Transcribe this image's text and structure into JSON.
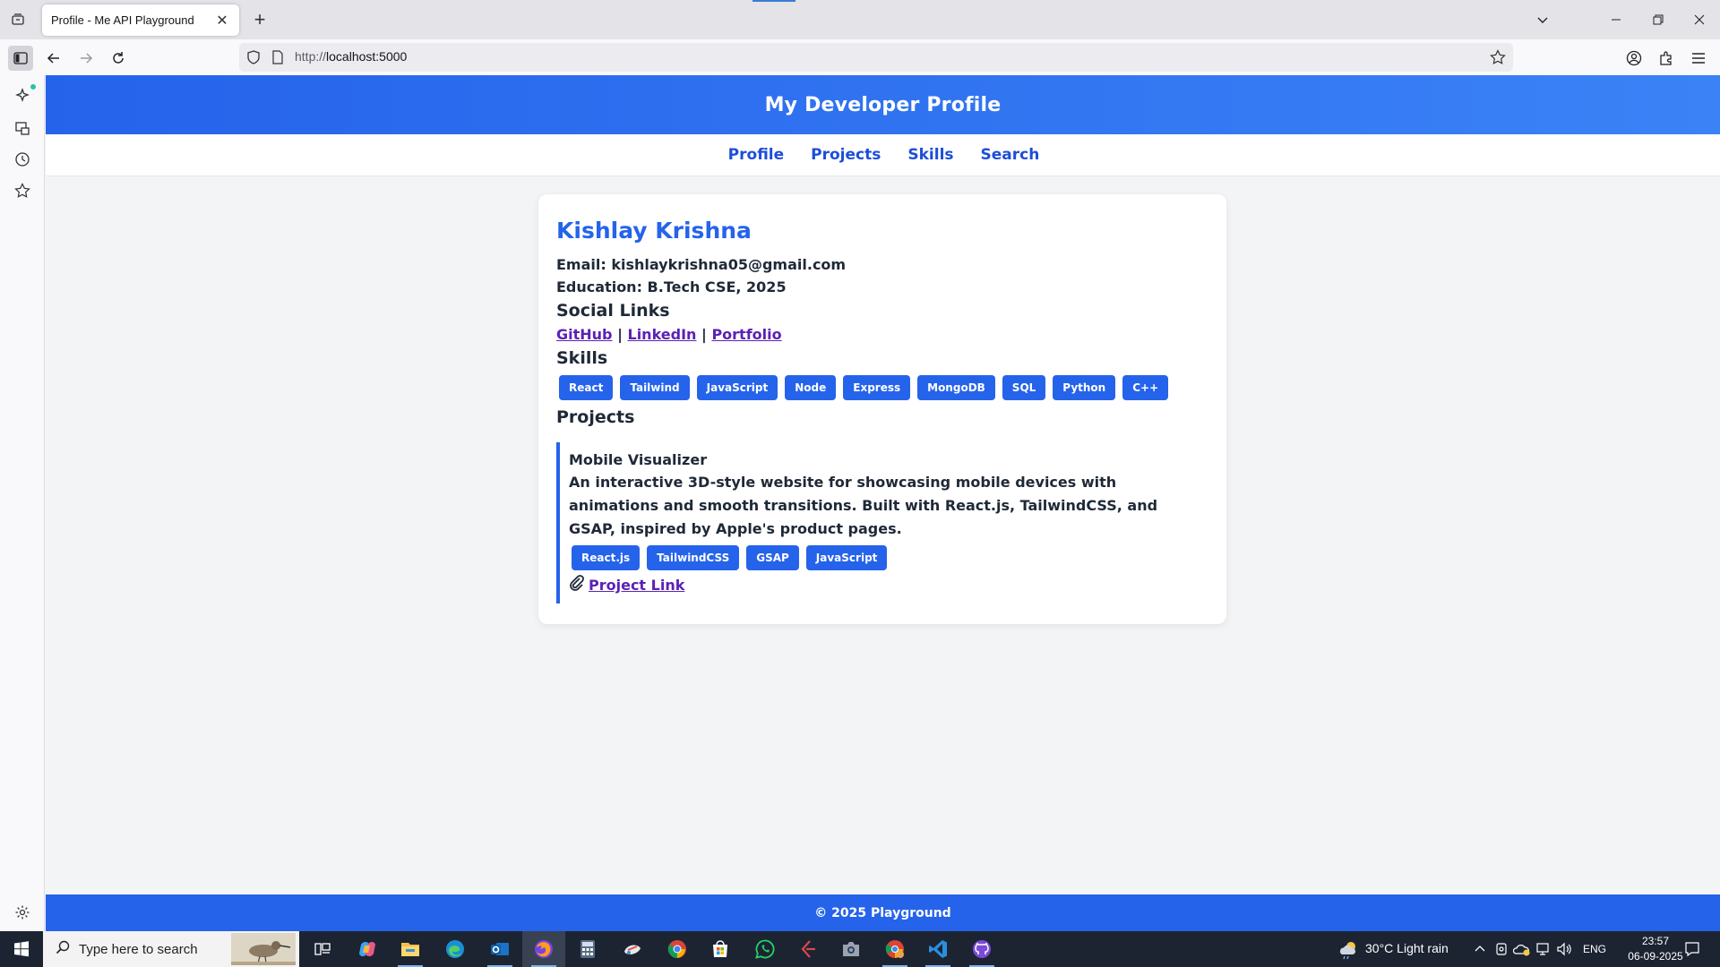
{
  "browser": {
    "tab_title": "Profile - Me API Playground",
    "url_scheme": "http://",
    "url_host": "localhost:5000"
  },
  "site": {
    "header_title": "My Developer Profile",
    "nav": [
      "Profile",
      "Projects",
      "Skills",
      "Search"
    ],
    "footer": "© 2025 Playground"
  },
  "profile": {
    "name": "Kishlay Krishna",
    "email_line": "Email: kishlaykrishna05@gmail.com",
    "education_line": "Education: B.Tech CSE, 2025",
    "social_heading": "Social Links",
    "links": [
      "GitHub",
      "LinkedIn",
      "Portfolio"
    ],
    "link_separator": "|",
    "skills_heading": "Skills",
    "skills": [
      "React",
      "Tailwind",
      "JavaScript",
      "Node",
      "Express",
      "MongoDB",
      "SQL",
      "Python",
      "C++"
    ],
    "projects_heading": "Projects",
    "projects": [
      {
        "title": "Mobile Visualizer",
        "description": "An interactive 3D-style website for showcasing mobile devices with animations and smooth transitions. Built with React.js, TailwindCSS, and GSAP, inspired by Apple's product pages.",
        "tech": [
          "React.js",
          "TailwindCSS",
          "GSAP",
          "JavaScript"
        ],
        "link_label": "Project Link",
        "link_icon": "paperclip-icon"
      }
    ]
  },
  "taskbar": {
    "search_placeholder": "Type here to search",
    "weather": "30°C  Light rain",
    "language": "ENG",
    "time": "23:57",
    "date": "06-09-2025"
  },
  "colors": {
    "accent": "#2563eb",
    "link_visited": "#5b21b6",
    "taskbar": "#1c2432"
  }
}
